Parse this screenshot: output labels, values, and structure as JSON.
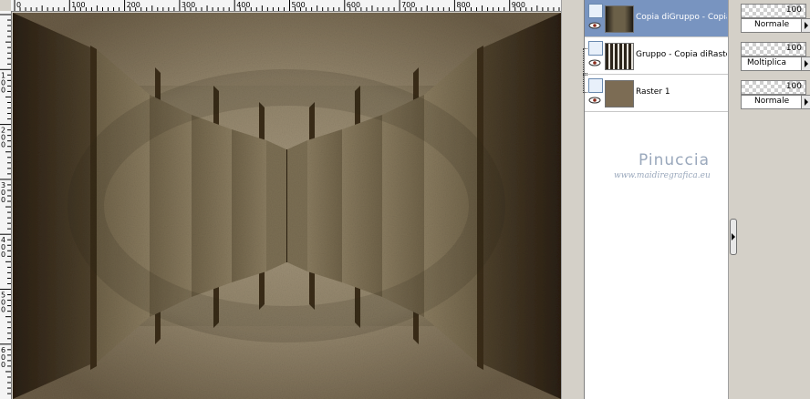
{
  "ruler": {
    "top_labels": [
      "0",
      "100",
      "200",
      "300",
      "400",
      "500",
      "600",
      "700",
      "800",
      "900"
    ],
    "left_labels": [
      "1 0 0",
      "2 0 0",
      "3 0 0",
      "4 0 0",
      "5 0 0",
      "6 0 0"
    ]
  },
  "layers": [
    {
      "name": "Copia diGruppo - Copia d",
      "selected": true,
      "thumb": "corridor-dark"
    },
    {
      "name": "Gruppo - Copia diRaster",
      "selected": false,
      "thumb": "corridor"
    },
    {
      "name": "Raster 1",
      "selected": false,
      "thumb": "solid-brown"
    }
  ],
  "properties": [
    {
      "opacity": "100",
      "blend_mode": "Normale"
    },
    {
      "opacity": "100",
      "blend_mode": "Moltiplica"
    },
    {
      "opacity": "100",
      "blend_mode": "Normale"
    }
  ],
  "watermark": {
    "title": "Pinuccia",
    "url": "www.maidiregrafica.eu"
  },
  "colors": {
    "selected_layer": "#7894c0",
    "panel_bg": "#d4d0c8",
    "canvas_wall": "#857860",
    "canvas_dark": "#3a2e1e"
  },
  "icons": {
    "visibility": "eye-icon",
    "layer_type": "raster-layer-icon",
    "splitter": "chevron-right-icon",
    "dropdown": "chevron-right-icon"
  }
}
